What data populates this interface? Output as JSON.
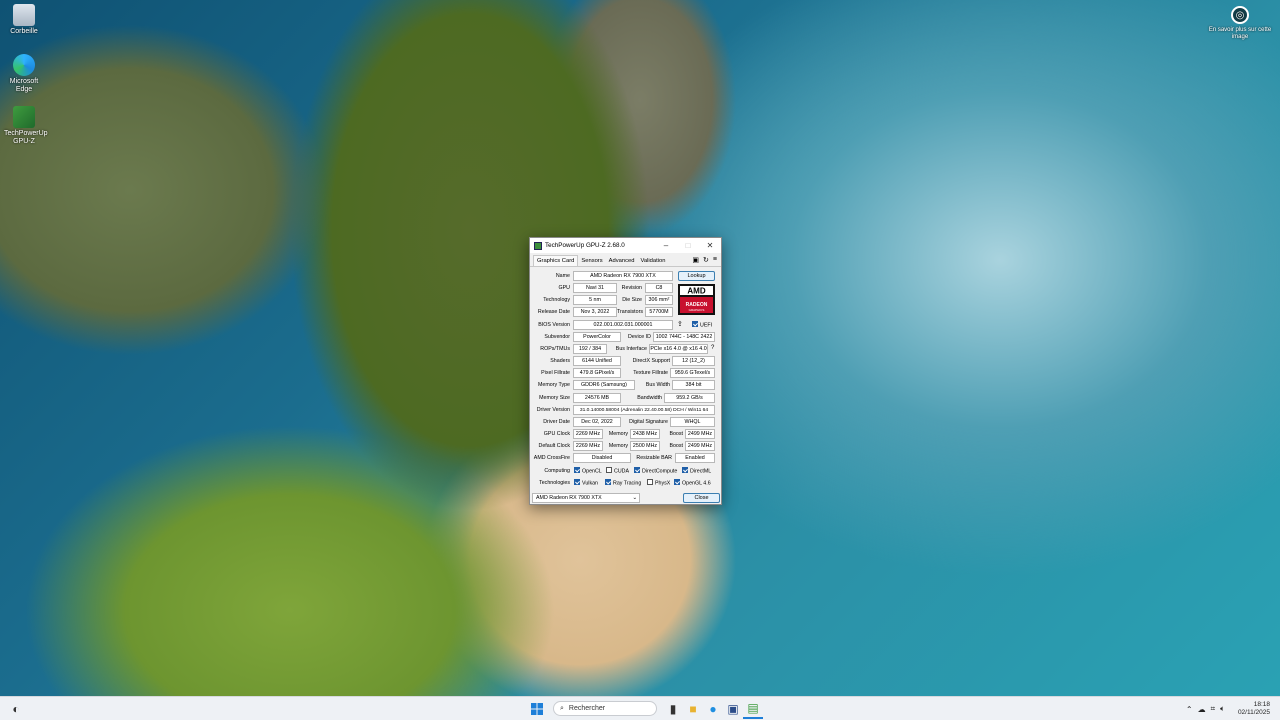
{
  "desktop": {
    "icons": [
      {
        "label": "Corbeille",
        "icon": "recycle-bin-icon"
      },
      {
        "label": "Microsoft Edge",
        "icon": "edge-icon"
      },
      {
        "label": "TechPowerUp GPU-Z",
        "icon": "gpuz-icon"
      }
    ],
    "corner_label": "En savoir plus sur cette image"
  },
  "window": {
    "title": "TechPowerUp GPU-Z 2.68.0",
    "tabs": [
      "Graphics Card",
      "Sensors",
      "Advanced",
      "Validation"
    ],
    "active_tab": "Graphics Card",
    "lookup_label": "Lookup",
    "close_label": "Close",
    "selected_gpu": "AMD Radeon RX 7900 XTX",
    "fields": {
      "name_label": "Name",
      "name": "AMD Radeon RX 7900 XTX",
      "gpu_label": "GPU",
      "gpu": "Navi 31",
      "revision_label": "Revision",
      "revision": "C8",
      "technology_label": "Technology",
      "technology": "5 nm",
      "die_size_label": "Die Size",
      "die_size": "306 mm²",
      "release_date_label": "Release Date",
      "release_date": "Nov 3, 2022",
      "transistors_label": "Transistors",
      "transistors": "57700M",
      "bios_label": "BIOS Version",
      "bios": "022.001.002.031.000001",
      "uefi_label": "UEFI",
      "subvendor_label": "Subvendor",
      "subvendor": "PowerColor",
      "device_id_label": "Device ID",
      "device_id": "1002 744C - 148C 2422",
      "rops_label": "ROPs/TMUs",
      "rops": "192 / 384",
      "bus_label": "Bus Interface",
      "bus": "PCIe x16 4.0 @ x16 4.0",
      "shaders_label": "Shaders",
      "shaders": "6144 Unified",
      "directx_label": "DirectX Support",
      "directx": "12 (12_2)",
      "pixel_label": "Pixel Fillrate",
      "pixel": "479.8 GPixel/s",
      "texture_label": "Texture Fillrate",
      "texture": "959.6 GTexel/s",
      "memtype_label": "Memory Type",
      "memtype": "GDDR6 (Samsung)",
      "buswidth_label": "Bus Width",
      "buswidth": "384 bit",
      "memsize_label": "Memory Size",
      "memsize": "24576 MB",
      "bandwidth_label": "Bandwidth",
      "bandwidth": "959.2 GB/s",
      "driver_label": "Driver Version",
      "driver": "31.0.14000.58004 (Adrenalin 22.40.00.58) DCH / Win11 64",
      "driverdate_label": "Driver Date",
      "driverdate": "Dec 02, 2022",
      "sig_label": "Digital Signature",
      "sig": "WHQL",
      "gpuclock_label": "GPU Clock",
      "gpuclock": "2269 MHz",
      "memory_label": "Memory",
      "memclock": "2438 MHz",
      "boost_label": "Boost",
      "boost": "2499 MHz",
      "defclock_label": "Default Clock",
      "defclock": "2269 MHz",
      "defmem": "2500 MHz",
      "defboost": "2499 MHz",
      "crossfire_label": "AMD CrossFire",
      "crossfire": "Disabled",
      "rebar_label": "Resizable BAR",
      "rebar": "Enabled",
      "computing_label": "Computing",
      "technologies_label": "Technologies"
    },
    "computing": [
      {
        "label": "OpenCL",
        "checked": true
      },
      {
        "label": "CUDA",
        "checked": false
      },
      {
        "label": "DirectCompute",
        "checked": true
      },
      {
        "label": "DirectML",
        "checked": true
      }
    ],
    "technologies": [
      {
        "label": "Vulkan",
        "checked": true
      },
      {
        "label": "Ray Tracing",
        "checked": true
      },
      {
        "label": "PhysX",
        "checked": false
      },
      {
        "label": "OpenGL 4.6",
        "checked": true
      }
    ]
  },
  "taskbar": {
    "search_placeholder": "Rechercher",
    "time": "18:18",
    "date": "02/11/2025"
  }
}
